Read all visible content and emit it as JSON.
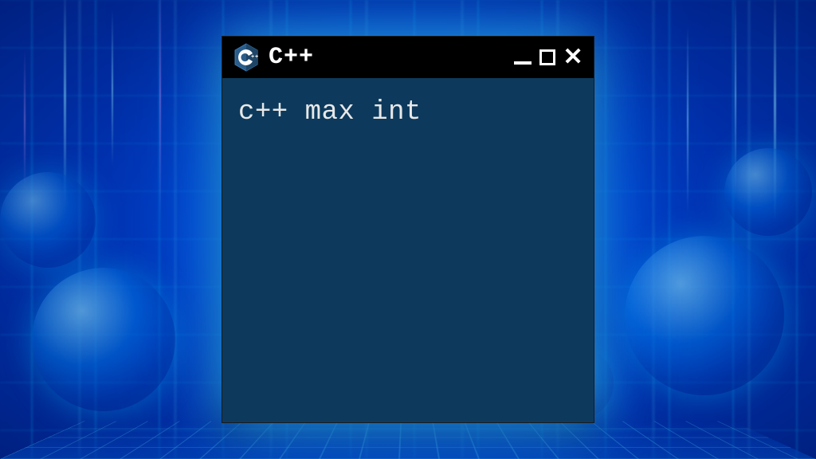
{
  "window": {
    "title": "C++",
    "icon_name": "cpp-hexagon-logo"
  },
  "content": {
    "code_line": "c++ max int"
  },
  "colors": {
    "titlebar_bg": "#000000",
    "content_bg": "#0d3a5c",
    "text": "#e8e8e8",
    "glow": "#32b4ff"
  }
}
